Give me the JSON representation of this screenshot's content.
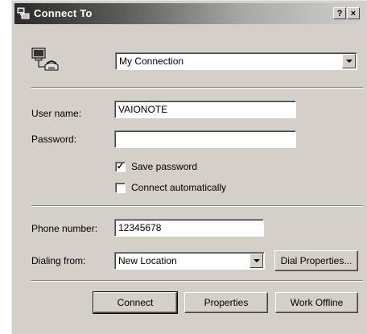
{
  "window": {
    "title": "Connect To",
    "help_glyph": "?",
    "close_glyph": "×"
  },
  "connection": {
    "selected": "My Connection"
  },
  "fields": {
    "username_label": "User name:",
    "username_value": "VAIONOTE",
    "password_label": "Password:",
    "password_value": "",
    "phone_label": "Phone number:",
    "phone_value": "12345678",
    "dialing_label": "Dialing from:",
    "dialing_value": "New Location"
  },
  "checkboxes": {
    "save_password": {
      "label": "Save password",
      "checked": true,
      "mark": "✓"
    },
    "connect_auto": {
      "label": "Connect automatically",
      "checked": false
    }
  },
  "buttons": {
    "dial_properties": "Dial Properties...",
    "connect": "Connect",
    "properties": "Properties",
    "work_offline": "Work Offline"
  }
}
